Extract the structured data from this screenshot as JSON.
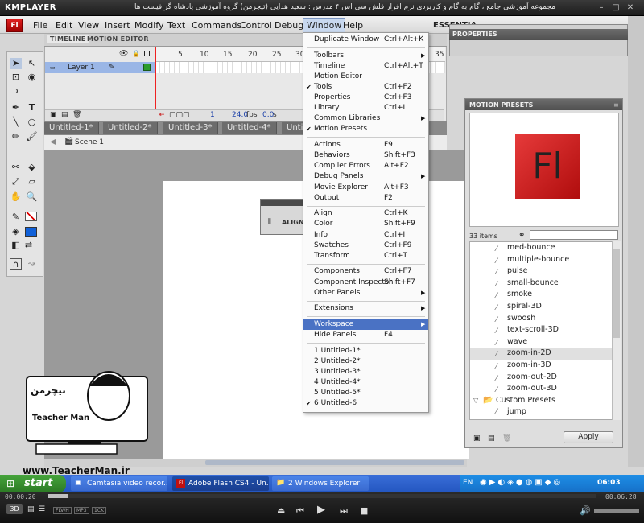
{
  "player": {
    "logo": "KMPLAYER",
    "caption": "مجموعه آموزشی جامع ، گام به گام و کاربردی نرم افزار فلش سی اس ۴ مدرس : سعید هدایی (تیچرمن) گروه آموزشی پادشاه گرافیست ها",
    "time_elapsed": "00:00:20",
    "time_total": "00:06:28",
    "progress_fraction": 0.035,
    "badges": [
      "FLV/H",
      "MP3",
      "1CK"
    ],
    "mode_badge": "3D"
  },
  "app": {
    "logo": "Fl",
    "menus": [
      "File",
      "Edit",
      "View",
      "Insert",
      "Modify",
      "Text",
      "Commands",
      "Control",
      "Debug",
      "Window",
      "Help"
    ],
    "workspace": "ESSENTIA"
  },
  "timeline": {
    "tabs": [
      "TIMELINE",
      "MOTION EDITOR"
    ],
    "layer": "Layer 1",
    "ruler": [
      "5",
      "10",
      "15",
      "20",
      "25",
      "30",
      "35",
      "65",
      "70",
      "75",
      "80",
      "85",
      "9"
    ],
    "frame": "1",
    "fps": "24.0",
    "fps_unit": "fps",
    "time": "0.0",
    "time_unit": "s"
  },
  "documents": {
    "tabs": [
      "Untitled-1*",
      "Untitled-2*",
      "Untitled-3*",
      "Untitled-4*",
      "Unti"
    ],
    "scene": "Scene 1",
    "align_label": "ALIGN"
  },
  "properties": {
    "title": "PROPERTIES"
  },
  "presets": {
    "title": "MOTION PRESETS",
    "preview_logo": "Fl",
    "count": "33 items",
    "items": [
      "med-bounce",
      "multiple-bounce",
      "pulse",
      "small-bounce",
      "smoke",
      "spiral-3D",
      "swoosh",
      "text-scroll-3D",
      "wave",
      "zoom-in-2D",
      "zoom-in-3D",
      "zoom-out-2D",
      "zoom-out-3D"
    ],
    "selected": "zoom-in-2D",
    "folder": "Custom Presets",
    "folder_item": "jump",
    "apply": "Apply"
  },
  "window_menu": {
    "groups": [
      [
        {
          "label": "Duplicate Window",
          "shortcut": "Ctrl+Alt+K"
        }
      ],
      [
        {
          "label": "Toolbars",
          "arrow": true
        },
        {
          "label": "Timeline",
          "shortcut": "Ctrl+Alt+T"
        },
        {
          "label": "Motion Editor"
        },
        {
          "label": "Tools",
          "shortcut": "Ctrl+F2",
          "checked": true
        },
        {
          "label": "Properties",
          "shortcut": "Ctrl+F3"
        },
        {
          "label": "Library",
          "shortcut": "Ctrl+L"
        },
        {
          "label": "Common Libraries",
          "arrow": true
        },
        {
          "label": "Motion Presets",
          "checked": true
        }
      ],
      [
        {
          "label": "Actions",
          "shortcut": "F9"
        },
        {
          "label": "Behaviors",
          "shortcut": "Shift+F3"
        },
        {
          "label": "Compiler Errors",
          "shortcut": "Alt+F2"
        },
        {
          "label": "Debug Panels",
          "arrow": true
        },
        {
          "label": "Movie Explorer",
          "shortcut": "Alt+F3"
        },
        {
          "label": "Output",
          "shortcut": "F2"
        }
      ],
      [
        {
          "label": "Align",
          "shortcut": "Ctrl+K"
        },
        {
          "label": "Color",
          "shortcut": "Shift+F9"
        },
        {
          "label": "Info",
          "shortcut": "Ctrl+I"
        },
        {
          "label": "Swatches",
          "shortcut": "Ctrl+F9"
        },
        {
          "label": "Transform",
          "shortcut": "Ctrl+T"
        }
      ],
      [
        {
          "label": "Components",
          "shortcut": "Ctrl+F7"
        },
        {
          "label": "Component Inspector",
          "shortcut": "Shift+F7"
        },
        {
          "label": "Other Panels",
          "arrow": true
        }
      ],
      [
        {
          "label": "Extensions",
          "arrow": true
        }
      ],
      [
        {
          "label": "Workspace",
          "arrow": true,
          "highlighted": true
        },
        {
          "label": "Hide Panels",
          "shortcut": "F4"
        }
      ],
      [
        {
          "label": "1 Untitled-1*"
        },
        {
          "label": "2 Untitled-2*"
        },
        {
          "label": "3 Untitled-3*"
        },
        {
          "label": "4 Untitled-4*"
        },
        {
          "label": "5 Untitled-5*"
        },
        {
          "label": "6 Untitled-6",
          "checked": true
        }
      ]
    ]
  },
  "branding": {
    "mascot_title": "تیچرمن",
    "mascot_subtitle": "Teacher Man",
    "website": "www.TeacherMan.ir"
  },
  "taskbar": {
    "start": "start",
    "tasks": [
      "Camtasia video recor...",
      "Adobe Flash CS4 - Un...",
      "2 Windows Explorer"
    ],
    "language": "EN",
    "clock": "06:03"
  }
}
